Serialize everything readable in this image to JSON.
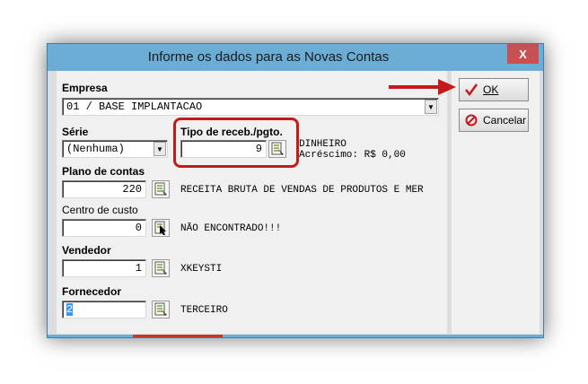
{
  "window": {
    "title": "Informe os dados para as Novas Contas",
    "close": "X"
  },
  "empresa": {
    "label": "Empresa",
    "value": "01 / BASE IMPLANTACAO"
  },
  "serie": {
    "label": "Série",
    "value": "(Nenhuma)"
  },
  "tipo": {
    "label": "Tipo de receb./pgto.",
    "value": "9",
    "desc1": "DINHEIRO",
    "desc2": "Acréscimo: R$ 0,00"
  },
  "plano": {
    "label": "Plano de contas",
    "value": "220",
    "desc": "RECEITA BRUTA DE VENDAS DE PRODUTOS E MER"
  },
  "centro": {
    "label": "Centro de custo",
    "value": "0",
    "desc": "NÃO ENCONTRADO!!!"
  },
  "vendedor": {
    "label": "Vendedor",
    "value": "1",
    "desc": "XKEYSTI"
  },
  "fornecedor": {
    "label": "Fornecedor",
    "value": "2",
    "desc": "TERCEIRO"
  },
  "buttons": {
    "ok": "OK",
    "cancel": "Cancelar"
  },
  "colors": {
    "annotation": "#c41a1a",
    "titlebar": "#6cadd6",
    "close": "#c75050"
  }
}
